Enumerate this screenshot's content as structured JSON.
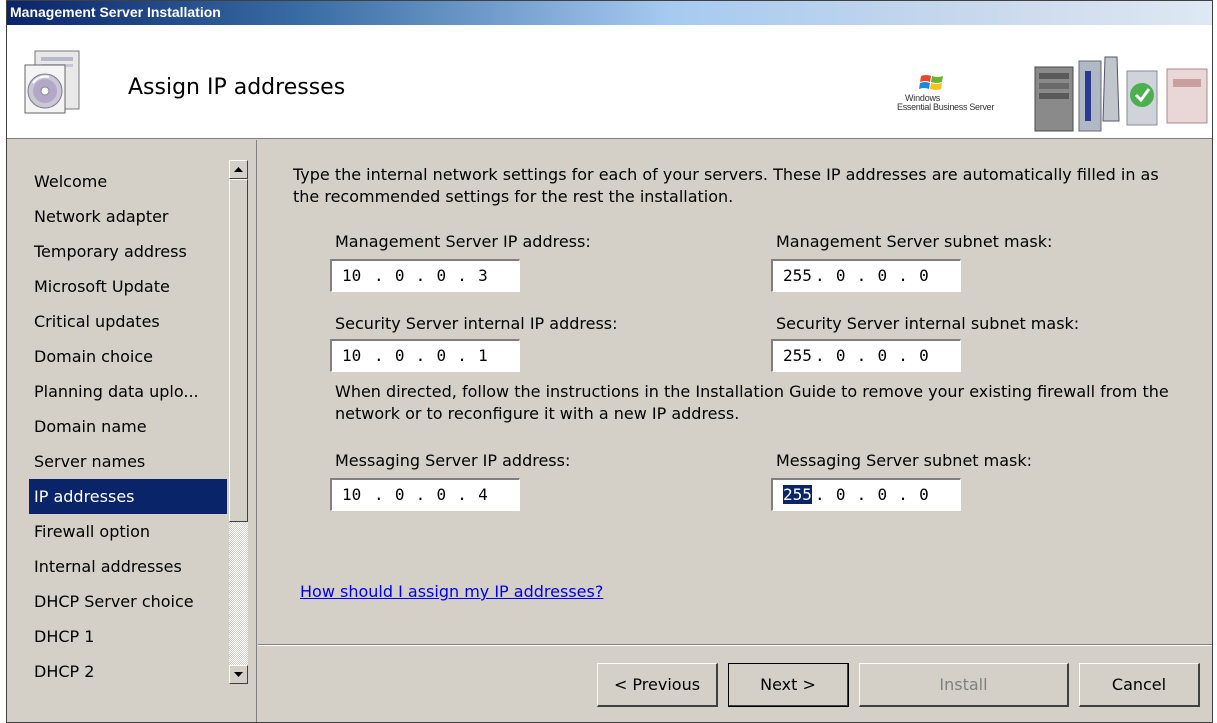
{
  "window": {
    "title": "Management Server Installation"
  },
  "header": {
    "title": "Assign IP addresses",
    "brand_line1": "Windows",
    "brand_line2": "Essential Business Server"
  },
  "nav": {
    "items": [
      {
        "label": "Welcome",
        "selected": false
      },
      {
        "label": "Network adapter",
        "selected": false
      },
      {
        "label": "Temporary address",
        "selected": false
      },
      {
        "label": "Microsoft Update",
        "selected": false
      },
      {
        "label": "Critical updates",
        "selected": false
      },
      {
        "label": "Domain choice",
        "selected": false
      },
      {
        "label": "Planning data uplo...",
        "selected": false
      },
      {
        "label": "Domain name",
        "selected": false
      },
      {
        "label": "Server names",
        "selected": false
      },
      {
        "label": "IP addresses",
        "selected": true
      },
      {
        "label": "Firewall option",
        "selected": false
      },
      {
        "label": "Internal addresses",
        "selected": false
      },
      {
        "label": "DHCP Server choice",
        "selected": false
      },
      {
        "label": "DHCP 1",
        "selected": false
      },
      {
        "label": "DHCP 2",
        "selected": false
      }
    ]
  },
  "content": {
    "intro": "Type the internal network settings for each of your servers. These IP addresses are automatically filled in as the recommended settings for the rest the installation.",
    "mgmt_ip_label": "Management Server IP address:",
    "mgmt_ip": [
      "10",
      "0",
      "0",
      "3"
    ],
    "mgmt_mask_label": "Management Server subnet mask:",
    "mgmt_mask": [
      "255",
      "0",
      "0",
      "0"
    ],
    "sec_ip_label": "Security Server internal IP address:",
    "sec_ip": [
      "10",
      "0",
      "0",
      "1"
    ],
    "sec_mask_label": "Security Server internal subnet mask:",
    "sec_mask": [
      "255",
      "0",
      "0",
      "0"
    ],
    "note": "When directed, follow the instructions in the Installation Guide to remove your existing firewall from the network or to reconfigure it with a new IP address.",
    "msg_ip_label": "Messaging Server IP address:",
    "msg_ip": [
      "10",
      "0",
      "0",
      "4"
    ],
    "msg_mask_label": "Messaging Server subnet mask:",
    "msg_mask": [
      "255",
      "0",
      "0",
      "0"
    ],
    "help_link": "How should I assign my IP addresses?"
  },
  "buttons": {
    "previous": "< Previous",
    "next": "Next >",
    "install": "Install",
    "cancel": "Cancel"
  }
}
